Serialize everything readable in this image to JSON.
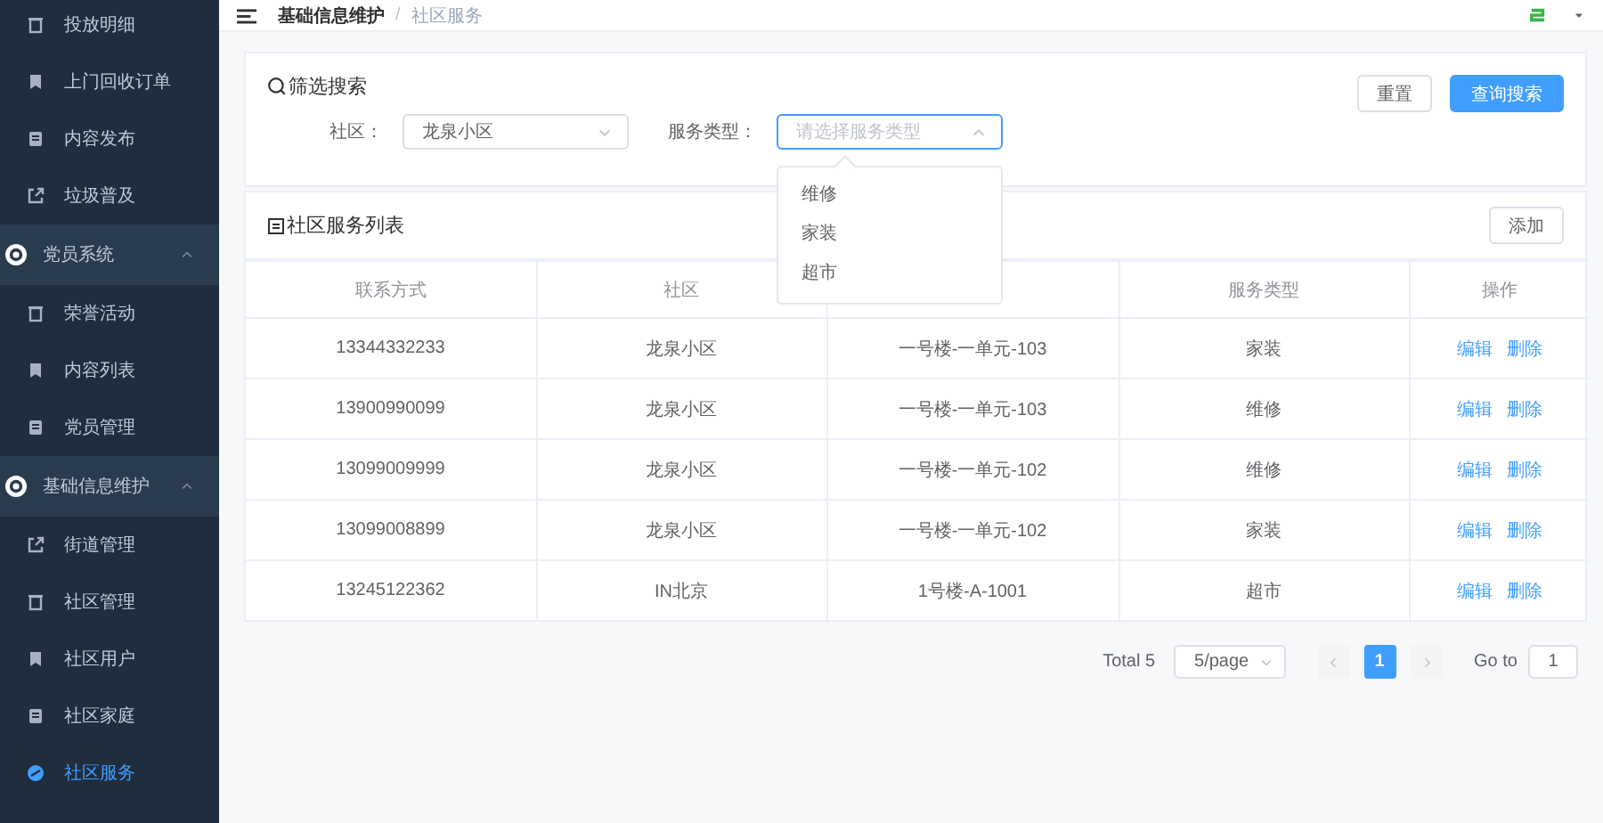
{
  "sidebar": {
    "items": [
      {
        "kind": "item",
        "label": "投放明细",
        "selected": false
      },
      {
        "kind": "item",
        "label": "上门回收订单",
        "selected": false
      },
      {
        "kind": "item",
        "label": "内容发布",
        "selected": false
      },
      {
        "kind": "item",
        "label": "垃圾普及",
        "selected": false
      },
      {
        "kind": "group",
        "label": "党员系统",
        "expanded": true,
        "children": [
          {
            "kind": "item",
            "label": "荣誉活动",
            "selected": false
          },
          {
            "kind": "item",
            "label": "内容列表",
            "selected": false
          },
          {
            "kind": "item",
            "label": "党员管理",
            "selected": false
          }
        ]
      },
      {
        "kind": "group",
        "label": "基础信息维护",
        "expanded": true,
        "children": [
          {
            "kind": "item",
            "label": "街道管理",
            "selected": false
          },
          {
            "kind": "item",
            "label": "社区管理",
            "selected": false
          },
          {
            "kind": "item",
            "label": "社区用户",
            "selected": false
          },
          {
            "kind": "item",
            "label": "社区家庭",
            "selected": false
          },
          {
            "kind": "item",
            "label": "社区服务",
            "selected": true
          }
        ]
      }
    ]
  },
  "header": {
    "breadcrumb": [
      "基础信息维护",
      "社区服务"
    ],
    "separator": "/"
  },
  "search": {
    "title": "筛选搜索",
    "filters": [
      {
        "label": "社区：",
        "value": "龙泉小区",
        "open": false
      },
      {
        "label": "服务类型：",
        "placeholder": "请选择服务类型",
        "open": true,
        "options": [
          {
            "label": "维修",
            "selected": false
          },
          {
            "label": "家装",
            "selected": false
          },
          {
            "label": "超市",
            "selected": false
          }
        ]
      }
    ],
    "buttons": [
      {
        "label": "重置",
        "kind": "default"
      },
      {
        "label": "查询搜索",
        "kind": "primary"
      }
    ]
  },
  "list": {
    "title": "社区服务列表",
    "add_button": "添加",
    "table": {
      "columns": [
        "联系方式",
        "社区",
        null,
        "服务类型",
        "操作"
      ],
      "rows": [
        {
          "phone": "13344332233",
          "community": "龙泉小区",
          "address": "一号楼-一单元-103",
          "service_type": "家装",
          "actions": [
            "编辑",
            "删除"
          ]
        },
        {
          "phone": "13900990099",
          "community": "龙泉小区",
          "address": "一号楼-一单元-103",
          "service_type": "维修",
          "actions": [
            "编辑",
            "删除"
          ]
        },
        {
          "phone": "13099009999",
          "community": "龙泉小区",
          "address": "一号楼-一单元-102",
          "service_type": "维修",
          "actions": [
            "编辑",
            "删除"
          ]
        },
        {
          "phone": "13099008899",
          "community": "龙泉小区",
          "address": "一号楼-一单元-102",
          "service_type": "家装",
          "actions": [
            "编辑",
            "删除"
          ]
        },
        {
          "phone": "13245122362",
          "community": "IN北京",
          "address": "1号楼-A-1001",
          "service_type": "超市",
          "actions": [
            "编辑",
            "删除"
          ]
        }
      ]
    }
  },
  "pagination": {
    "total": "Total 5",
    "page_size": "5/page",
    "pages": [
      {
        "label": "1",
        "selected": true
      }
    ],
    "goto_label": "Go to",
    "goto_value": "1"
  }
}
